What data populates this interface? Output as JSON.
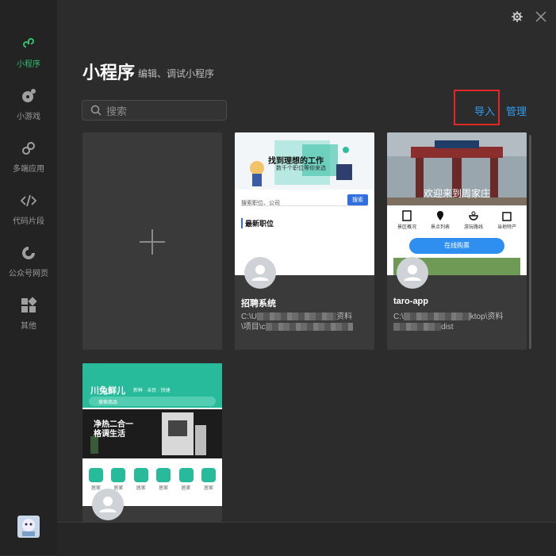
{
  "sidebar": {
    "items": [
      {
        "label": "小程序",
        "icon": "miniprogram-icon",
        "active": true
      },
      {
        "label": "小游戏",
        "icon": "minigame-icon"
      },
      {
        "label": "多端应用",
        "icon": "multiplatform-icon"
      },
      {
        "label": "代码片段",
        "icon": "code-snippet-icon"
      },
      {
        "label": "公众号网页",
        "icon": "official-account-icon"
      },
      {
        "label": "其他",
        "icon": "other-icon"
      }
    ]
  },
  "header": {
    "title": "小程序",
    "subtitle": "编辑、调试小程序"
  },
  "search": {
    "placeholder": "搜索"
  },
  "toolbar": {
    "import_label": "导入",
    "manage_label": "管理"
  },
  "projects": [
    {
      "name": "招聘系统",
      "path_line1": "C:\\U",
      "path_line1_tail": "资料",
      "path_line2": "\\项目\\c",
      "thumb": {
        "headline": "找到理想的工作",
        "sub": "数千个职位等你来选",
        "search_hint": "搜索职位、公司",
        "search_btn": "搜索",
        "section": "最新职位"
      }
    },
    {
      "name": "taro-app",
      "path_line1": "C:\\",
      "path_line1_tail": "ktop\\资料",
      "path_line2": "",
      "path_line2_tail": "dist",
      "thumb": {
        "banner": "欢迎来到周家庄",
        "tabs": [
          "景区概况",
          "景点列表",
          "游玩路线",
          "当地特产"
        ],
        "button": "在线购票"
      }
    },
    {
      "name": "",
      "thumb": {
        "brand": "川兔鲜儿",
        "tagline": "新鲜 · 亲民 · 快捷",
        "search_hint": "搜索商品",
        "promo": [
          "净热二合一",
          "格调生活"
        ],
        "grid_label": "居家"
      }
    }
  ],
  "colors": {
    "accent": "#2fbf6f",
    "link": "#2f9cf0",
    "highlight": "#e32626"
  }
}
